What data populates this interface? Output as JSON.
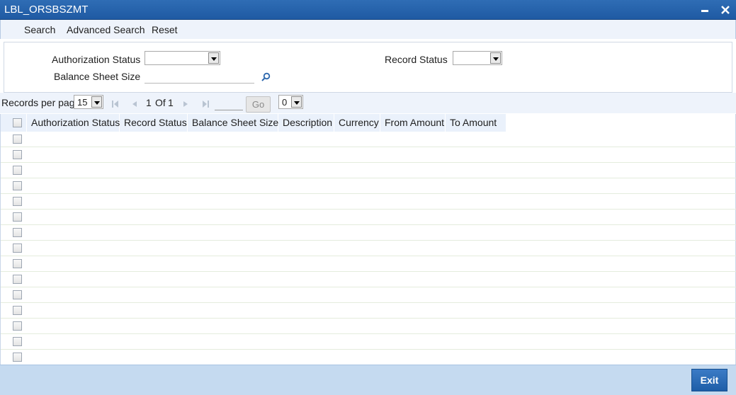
{
  "window": {
    "title": "LBL_ORSBSZMT"
  },
  "menu": {
    "search": "Search",
    "advanced_search": "Advanced Search",
    "reset": "Reset"
  },
  "search": {
    "authorization_status_label": "Authorization Status",
    "authorization_status_value": "",
    "record_status_label": "Record Status",
    "record_status_value": "",
    "balance_sheet_size_label": "Balance Sheet Size",
    "balance_sheet_size_value": ""
  },
  "pager": {
    "records_per_page_label": "Records per page",
    "records_per_page_value": "15",
    "current_page": "1",
    "of_label": "Of",
    "total_pages": "1",
    "go_label": "Go",
    "jump_value": "0"
  },
  "grid": {
    "columns": [
      "Authorization Status",
      "Record Status",
      "Balance Sheet Size",
      "Description",
      "Currency",
      "From Amount",
      "To Amount"
    ],
    "empty_rows": 15
  },
  "footer": {
    "exit_label": "Exit"
  },
  "colors": {
    "title_bar": "#2a67b1",
    "toolbar_bg": "#eef3fb",
    "footer_bg": "#c5daf0",
    "exit_button": "#2a6db8"
  }
}
